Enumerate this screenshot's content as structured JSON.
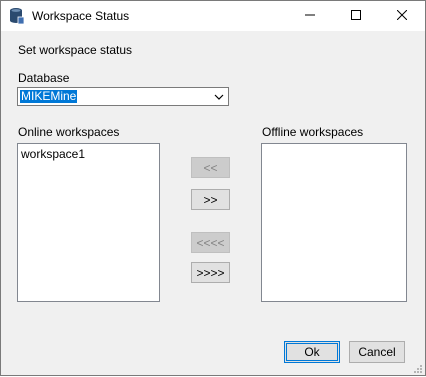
{
  "window": {
    "title": "Workspace Status",
    "icon": "database-icon",
    "controls": {
      "minimize": "minimize-icon",
      "maximize": "maximize-icon",
      "close": "close-icon"
    }
  },
  "form": {
    "heading": "Set workspace status",
    "database_label": "Database",
    "database_value": "MIKEMine",
    "online_label": "Online workspaces",
    "offline_label": "Offline workspaces",
    "online_items": [
      "workspace1"
    ],
    "offline_items": []
  },
  "buttons": {
    "move_left": "<<",
    "move_right": ">>",
    "move_all_left": "<<<<",
    "move_all_right": ">>>>",
    "ok": "Ok",
    "cancel": "Cancel"
  },
  "colors": {
    "selection": "#0078d7",
    "dialog_background": "#f0f0f0",
    "button_face": "#e1e1e1",
    "disabled_text": "#838383"
  }
}
